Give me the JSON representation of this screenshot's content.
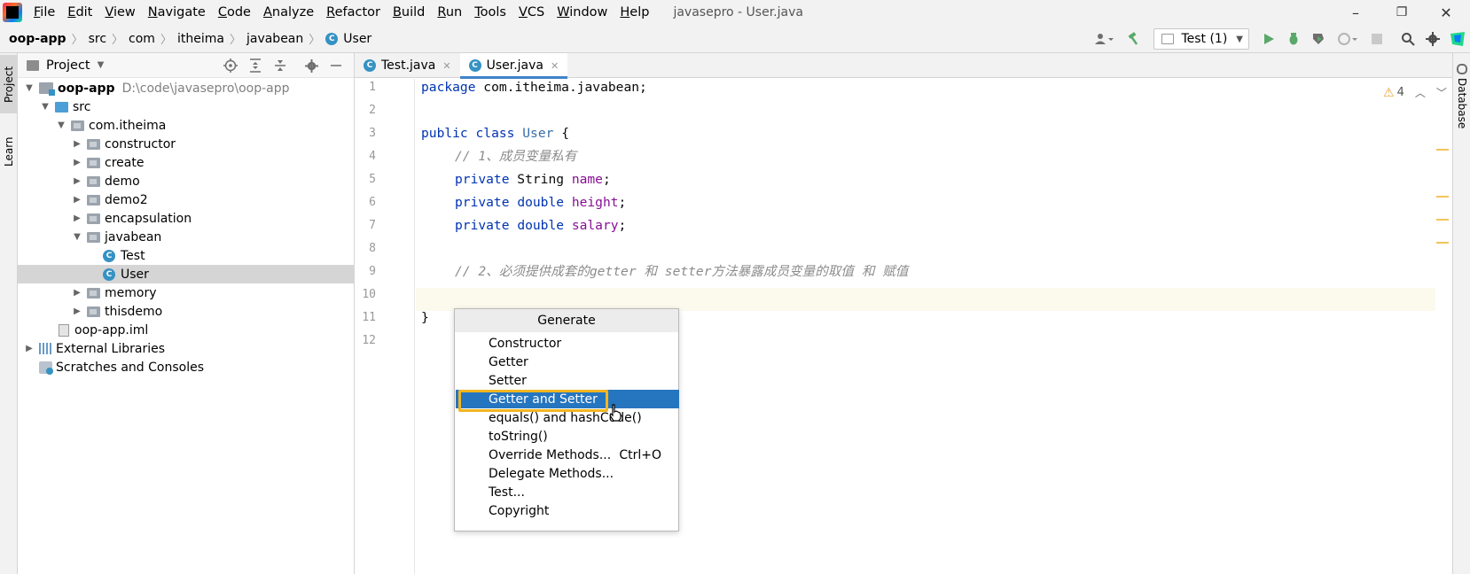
{
  "window": {
    "title": "javasepro - User.java",
    "menu": [
      "File",
      "Edit",
      "View",
      "Navigate",
      "Code",
      "Analyze",
      "Refactor",
      "Build",
      "Run",
      "Tools",
      "VCS",
      "Window",
      "Help"
    ],
    "minimize": "–",
    "restore": "❐",
    "close": "✕"
  },
  "breadcrumb": [
    "oop-app",
    "src",
    "com",
    "itheima",
    "javabean",
    "User"
  ],
  "toolbar": {
    "run_config": "Test (1)",
    "icons": [
      "user-icon",
      "build-hammer-icon",
      "run-icon",
      "debug-icon",
      "coverage-icon",
      "profile-icon",
      "stop-icon",
      "search-icon",
      "settings-icon",
      "jetbrains-toolbox-icon"
    ]
  },
  "left_strip": {
    "project_tab": "Project",
    "learn_tab": "Learn"
  },
  "right_strip": {
    "database_tab": "Database"
  },
  "project_panel": {
    "title": "Project",
    "tree": [
      {
        "label": "oop-app",
        "path": "D:\\code\\javasepro\\oop-app",
        "type": "module",
        "bold": true,
        "expanded": true,
        "depth": 0
      },
      {
        "label": "src",
        "type": "src-folder",
        "expanded": true,
        "depth": 1
      },
      {
        "label": "com.itheima",
        "type": "package",
        "expanded": true,
        "depth": 2
      },
      {
        "label": "constructor",
        "type": "package",
        "expanded": false,
        "depth": 3
      },
      {
        "label": "create",
        "type": "package",
        "expanded": false,
        "depth": 3
      },
      {
        "label": "demo",
        "type": "package",
        "expanded": false,
        "depth": 3
      },
      {
        "label": "demo2",
        "type": "package",
        "expanded": false,
        "depth": 3
      },
      {
        "label": "encapsulation",
        "type": "package",
        "expanded": false,
        "depth": 3
      },
      {
        "label": "javabean",
        "type": "package",
        "expanded": true,
        "depth": 3
      },
      {
        "label": "Test",
        "type": "class",
        "depth": 4
      },
      {
        "label": "User",
        "type": "class",
        "depth": 4,
        "selected": true
      },
      {
        "label": "memory",
        "type": "package",
        "expanded": false,
        "depth": 3
      },
      {
        "label": "thisdemo",
        "type": "package",
        "expanded": false,
        "depth": 3
      },
      {
        "label": "oop-app.iml",
        "type": "iml",
        "depth": 1
      },
      {
        "label": "External Libraries",
        "type": "libraries",
        "expanded": false,
        "depth": 0
      },
      {
        "label": "Scratches and Consoles",
        "type": "scratches",
        "depth": 0
      }
    ]
  },
  "editor": {
    "tabs": [
      {
        "label": "Test.java",
        "active": false
      },
      {
        "label": "User.java",
        "active": true
      }
    ],
    "line_numbers": [
      "1",
      "2",
      "3",
      "4",
      "5",
      "6",
      "7",
      "8",
      "9",
      "10",
      "11",
      "12"
    ],
    "code": {
      "l1_kw": "package",
      "l1_rest": " com.itheima.javabean;",
      "l3_kw1": "public",
      "l3_kw2": "class",
      "l3_name": "User",
      "l3_rest": " {",
      "l4_comment": "// 1、成员变量私有",
      "l5_kw": "private",
      "l5_type": " String ",
      "l5_field": "name",
      "l5_end": ";",
      "l6_kw": "private",
      "l6_type": "double",
      "l6_field": "height",
      "l6_end": ";",
      "l7_kw": "private",
      "l7_type": "double",
      "l7_field": "salary",
      "l7_end": ";",
      "l9_comment": "// 2、必须提供成套的getter 和 setter方法暴露成员变量的取值 和 赋值",
      "l11": "}"
    },
    "inspection_warnings": "4"
  },
  "generate_popup": {
    "title": "Generate",
    "items": [
      {
        "label": "Constructor",
        "shortcut": ""
      },
      {
        "label": "Getter",
        "shortcut": ""
      },
      {
        "label": "Setter",
        "shortcut": ""
      },
      {
        "label": "Getter and Setter",
        "shortcut": "",
        "selected": true
      },
      {
        "label": "equals() and hashCode()",
        "shortcut": ""
      },
      {
        "label": "toString()",
        "shortcut": ""
      },
      {
        "label": "Override Methods...",
        "shortcut": "Ctrl+O"
      },
      {
        "label": "Delegate Methods...",
        "shortcut": ""
      },
      {
        "label": "Test...",
        "shortcut": ""
      },
      {
        "label": "Copyright",
        "shortcut": ""
      }
    ]
  }
}
